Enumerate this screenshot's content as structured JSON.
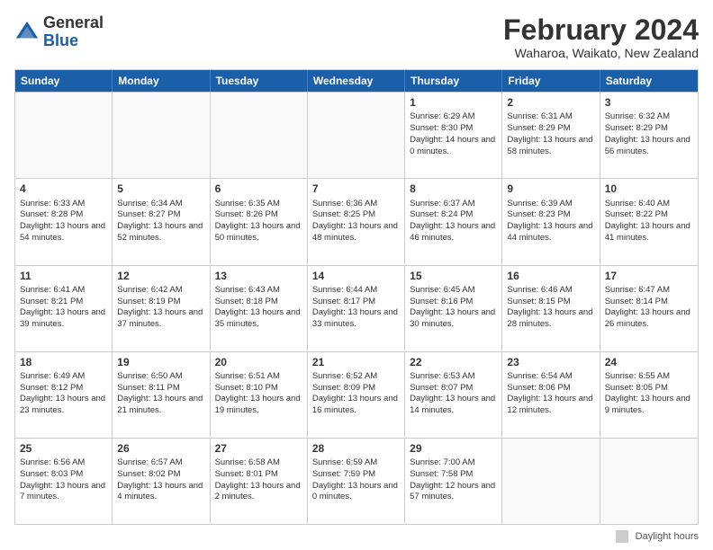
{
  "logo": {
    "general": "General",
    "blue": "Blue"
  },
  "title": {
    "month_year": "February 2024",
    "location": "Waharoa, Waikato, New Zealand"
  },
  "days_of_week": [
    "Sunday",
    "Monday",
    "Tuesday",
    "Wednesday",
    "Thursday",
    "Friday",
    "Saturday"
  ],
  "weeks": [
    [
      {
        "day": "",
        "sunrise": "",
        "sunset": "",
        "daylight": "",
        "empty": true
      },
      {
        "day": "",
        "sunrise": "",
        "sunset": "",
        "daylight": "",
        "empty": true
      },
      {
        "day": "",
        "sunrise": "",
        "sunset": "",
        "daylight": "",
        "empty": true
      },
      {
        "day": "",
        "sunrise": "",
        "sunset": "",
        "daylight": "",
        "empty": true
      },
      {
        "day": "1",
        "sunrise": "Sunrise: 6:29 AM",
        "sunset": "Sunset: 8:30 PM",
        "daylight": "Daylight: 14 hours and 0 minutes."
      },
      {
        "day": "2",
        "sunrise": "Sunrise: 6:31 AM",
        "sunset": "Sunset: 8:29 PM",
        "daylight": "Daylight: 13 hours and 58 minutes."
      },
      {
        "day": "3",
        "sunrise": "Sunrise: 6:32 AM",
        "sunset": "Sunset: 8:29 PM",
        "daylight": "Daylight: 13 hours and 56 minutes."
      }
    ],
    [
      {
        "day": "4",
        "sunrise": "Sunrise: 6:33 AM",
        "sunset": "Sunset: 8:28 PM",
        "daylight": "Daylight: 13 hours and 54 minutes."
      },
      {
        "day": "5",
        "sunrise": "Sunrise: 6:34 AM",
        "sunset": "Sunset: 8:27 PM",
        "daylight": "Daylight: 13 hours and 52 minutes."
      },
      {
        "day": "6",
        "sunrise": "Sunrise: 6:35 AM",
        "sunset": "Sunset: 8:26 PM",
        "daylight": "Daylight: 13 hours and 50 minutes."
      },
      {
        "day": "7",
        "sunrise": "Sunrise: 6:36 AM",
        "sunset": "Sunset: 8:25 PM",
        "daylight": "Daylight: 13 hours and 48 minutes."
      },
      {
        "day": "8",
        "sunrise": "Sunrise: 6:37 AM",
        "sunset": "Sunset: 8:24 PM",
        "daylight": "Daylight: 13 hours and 46 minutes."
      },
      {
        "day": "9",
        "sunrise": "Sunrise: 6:39 AM",
        "sunset": "Sunset: 8:23 PM",
        "daylight": "Daylight: 13 hours and 44 minutes."
      },
      {
        "day": "10",
        "sunrise": "Sunrise: 6:40 AM",
        "sunset": "Sunset: 8:22 PM",
        "daylight": "Daylight: 13 hours and 41 minutes."
      }
    ],
    [
      {
        "day": "11",
        "sunrise": "Sunrise: 6:41 AM",
        "sunset": "Sunset: 8:21 PM",
        "daylight": "Daylight: 13 hours and 39 minutes."
      },
      {
        "day": "12",
        "sunrise": "Sunrise: 6:42 AM",
        "sunset": "Sunset: 8:19 PM",
        "daylight": "Daylight: 13 hours and 37 minutes."
      },
      {
        "day": "13",
        "sunrise": "Sunrise: 6:43 AM",
        "sunset": "Sunset: 8:18 PM",
        "daylight": "Daylight: 13 hours and 35 minutes."
      },
      {
        "day": "14",
        "sunrise": "Sunrise: 6:44 AM",
        "sunset": "Sunset: 8:17 PM",
        "daylight": "Daylight: 13 hours and 33 minutes."
      },
      {
        "day": "15",
        "sunrise": "Sunrise: 6:45 AM",
        "sunset": "Sunset: 8:16 PM",
        "daylight": "Daylight: 13 hours and 30 minutes."
      },
      {
        "day": "16",
        "sunrise": "Sunrise: 6:46 AM",
        "sunset": "Sunset: 8:15 PM",
        "daylight": "Daylight: 13 hours and 28 minutes."
      },
      {
        "day": "17",
        "sunrise": "Sunrise: 6:47 AM",
        "sunset": "Sunset: 8:14 PM",
        "daylight": "Daylight: 13 hours and 26 minutes."
      }
    ],
    [
      {
        "day": "18",
        "sunrise": "Sunrise: 6:49 AM",
        "sunset": "Sunset: 8:12 PM",
        "daylight": "Daylight: 13 hours and 23 minutes."
      },
      {
        "day": "19",
        "sunrise": "Sunrise: 6:50 AM",
        "sunset": "Sunset: 8:11 PM",
        "daylight": "Daylight: 13 hours and 21 minutes."
      },
      {
        "day": "20",
        "sunrise": "Sunrise: 6:51 AM",
        "sunset": "Sunset: 8:10 PM",
        "daylight": "Daylight: 13 hours and 19 minutes."
      },
      {
        "day": "21",
        "sunrise": "Sunrise: 6:52 AM",
        "sunset": "Sunset: 8:09 PM",
        "daylight": "Daylight: 13 hours and 16 minutes."
      },
      {
        "day": "22",
        "sunrise": "Sunrise: 6:53 AM",
        "sunset": "Sunset: 8:07 PM",
        "daylight": "Daylight: 13 hours and 14 minutes."
      },
      {
        "day": "23",
        "sunrise": "Sunrise: 6:54 AM",
        "sunset": "Sunset: 8:06 PM",
        "daylight": "Daylight: 13 hours and 12 minutes."
      },
      {
        "day": "24",
        "sunrise": "Sunrise: 6:55 AM",
        "sunset": "Sunset: 8:05 PM",
        "daylight": "Daylight: 13 hours and 9 minutes."
      }
    ],
    [
      {
        "day": "25",
        "sunrise": "Sunrise: 6:56 AM",
        "sunset": "Sunset: 8:03 PM",
        "daylight": "Daylight: 13 hours and 7 minutes."
      },
      {
        "day": "26",
        "sunrise": "Sunrise: 6:57 AM",
        "sunset": "Sunset: 8:02 PM",
        "daylight": "Daylight: 13 hours and 4 minutes."
      },
      {
        "day": "27",
        "sunrise": "Sunrise: 6:58 AM",
        "sunset": "Sunset: 8:01 PM",
        "daylight": "Daylight: 13 hours and 2 minutes."
      },
      {
        "day": "28",
        "sunrise": "Sunrise: 6:59 AM",
        "sunset": "Sunset: 7:59 PM",
        "daylight": "Daylight: 13 hours and 0 minutes."
      },
      {
        "day": "29",
        "sunrise": "Sunrise: 7:00 AM",
        "sunset": "Sunset: 7:58 PM",
        "daylight": "Daylight: 12 hours and 57 minutes."
      },
      {
        "day": "",
        "sunrise": "",
        "sunset": "",
        "daylight": "",
        "empty": true
      },
      {
        "day": "",
        "sunrise": "",
        "sunset": "",
        "daylight": "",
        "empty": true
      }
    ]
  ],
  "legend": {
    "label": "Daylight hours"
  }
}
